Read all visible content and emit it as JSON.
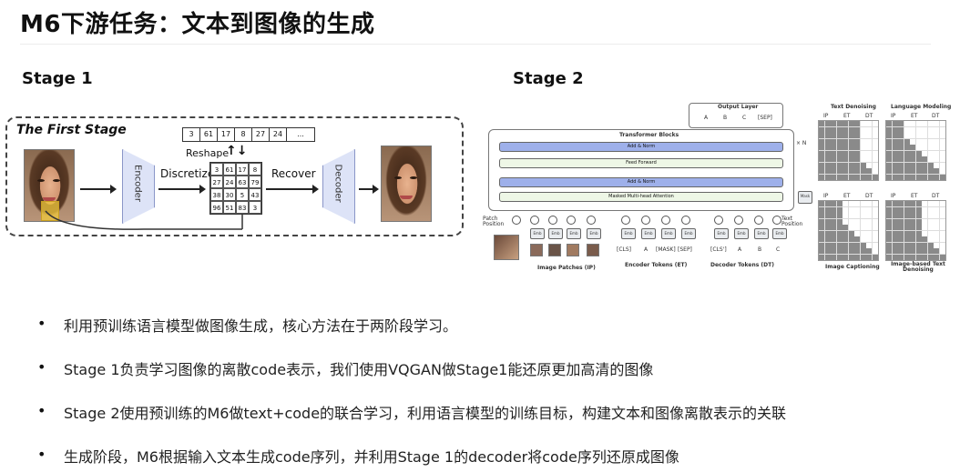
{
  "title": "M6下游任务：文本到图像的生成",
  "stage1": {
    "label": "Stage 1",
    "panel_title": "The First Stage",
    "encoder": "Encoder",
    "decoder": "Decoder",
    "discretize": "Discretize",
    "recover": "Recover",
    "reshape": "Reshape",
    "sequence": [
      "3",
      "61",
      "17",
      "8",
      "27",
      "24",
      "..."
    ],
    "grid": [
      "3",
      "61",
      "17",
      "8",
      "27",
      "24",
      "63",
      "79",
      "38",
      "30",
      "5",
      "43",
      "96",
      "51",
      "83",
      "3"
    ]
  },
  "stage2": {
    "label": "Stage 2",
    "output_layer": "Output Layer",
    "output_tokens": [
      "A",
      "B",
      "C",
      "[SEP]"
    ],
    "transformer_blocks": "Transformer Blocks",
    "times_n": "× N",
    "add_norm_1": "Add & Norm",
    "feed_forward": "Feed Forward",
    "add_norm_2": "Add & Norm",
    "masked_attention": "Masked Multi-head Attention",
    "mask_label": "Mask",
    "patch_position": "Patch Position",
    "text_position": "Text Position",
    "emb": "Emb",
    "encoder_tokens": [
      "[CLS]",
      "A",
      "[MASK]",
      "[SEP]"
    ],
    "decoder_tokens": [
      "[CLS']",
      "A",
      "B",
      "C"
    ],
    "image_patches_caption": "Image Patches (IP)",
    "encoder_tokens_caption": "Encoder Tokens (ET)",
    "decoder_tokens_caption": "Decoder Tokens (DT)",
    "task_text_denoising": "Text Denoising",
    "task_language_modeling": "Language Modeling",
    "task_image_captioning": "Image Captioning",
    "task_image_based_text_denoising": "Image-based Text Denoising",
    "col_ip": "IP",
    "col_et": "ET",
    "col_dt": "DT"
  },
  "bullets": [
    "利用预训练语言模型做图像生成，核心方法在于两阶段学习。",
    "Stage 1负责学习图像的离散code表示，我们使用VQGAN做Stage1能还原更加高清的图像",
    "Stage 2使用预训练的M6做text+code的联合学习，利用语言模型的训练目标，构建文本和图像离散表示的关联",
    "生成阶段，M6根据输入文本生成code序列，并利用Stage 1的decoder将code序列还原成图像"
  ],
  "colors": {
    "encoder_fill": "#dde3f7",
    "attention_bar": "#9eb0ea",
    "highlight_patch": "#f0c83c"
  }
}
